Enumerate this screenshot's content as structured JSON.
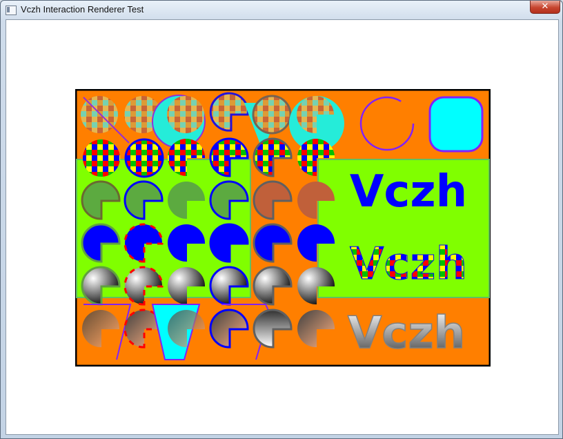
{
  "window": {
    "title": "Vczh Interaction Renderer Test",
    "close_glyph": "✕"
  },
  "canvas": {
    "texts": [
      "Vczh",
      "Vczh",
      "Vczh"
    ],
    "colors": {
      "background": "#ff7f00",
      "panel": "#80ff00",
      "blue": "#0000ff",
      "cyan": "#00ffff",
      "purple": "#8020ff"
    }
  }
}
